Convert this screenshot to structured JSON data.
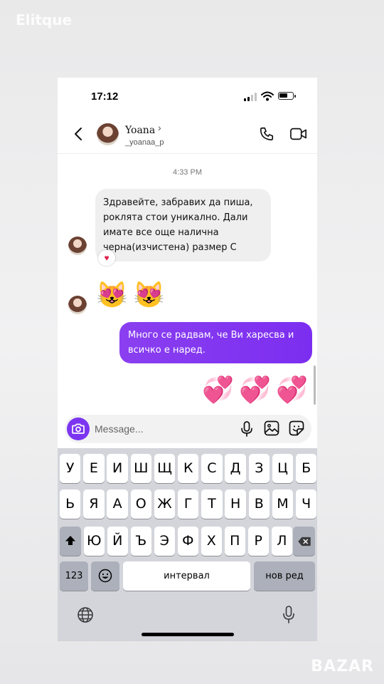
{
  "watermarks": {
    "top": "Elitque",
    "bottom": "BAZAR"
  },
  "status_bar": {
    "time": "17:12"
  },
  "header": {
    "name": "Yoana",
    "username": "_yoanaa_p"
  },
  "thread": {
    "timestamp": "4:33 PM",
    "incoming_text": "Здравейте, забравих да пиша, роклята стои уникално. Дали имате все още налична черна(изчистена) размер С",
    "reaction": "♥",
    "incoming_emoji": [
      "😻",
      "😻"
    ],
    "outgoing_text": "Много се радвам, че Ви харесва и всичко е наред.",
    "outgoing_emoji": [
      "💞",
      "💞",
      "💞"
    ]
  },
  "composer": {
    "placeholder": "Message..."
  },
  "keyboard": {
    "row1": [
      "У",
      "Е",
      "И",
      "Ш",
      "Щ",
      "К",
      "С",
      "Д",
      "З",
      "Ц",
      "Б"
    ],
    "row2": [
      "Ь",
      "Я",
      "А",
      "О",
      "Ж",
      "Г",
      "Т",
      "Н",
      "В",
      "М",
      "Ч"
    ],
    "row3": [
      "Ю",
      "Й",
      "Ъ",
      "Э",
      "Ф",
      "Х",
      "П",
      "Р",
      "Л"
    ],
    "numbers_label": "123",
    "space_label": "интервал",
    "return_label": "нов ред"
  }
}
